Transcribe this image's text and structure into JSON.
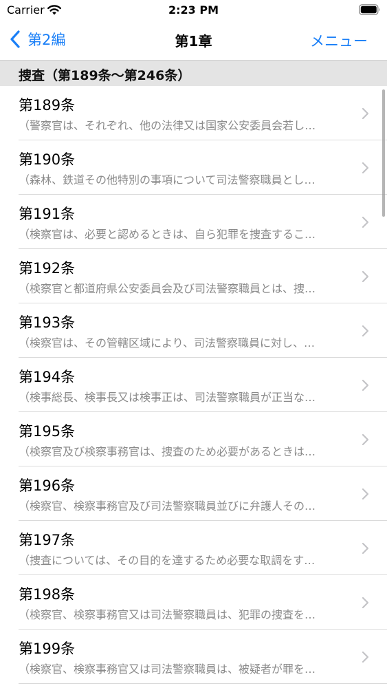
{
  "status_bar": {
    "carrier": "Carrier",
    "time": "2:23 PM"
  },
  "nav": {
    "back_label": "第2編",
    "title": "第1章",
    "menu_label": "メニュー"
  },
  "section": {
    "title": "捜査（第189条〜第246条）"
  },
  "rows": [
    {
      "title": "第189条",
      "subtitle": "（警察官は、それぞれ、他の法律又は国家公安委員会若し…"
    },
    {
      "title": "第190条",
      "subtitle": "（森林、鉄道その他特別の事項について司法警察職員とし…"
    },
    {
      "title": "第191条",
      "subtitle": "（検察官は、必要と認めるときは、自ら犯罪を捜査するこ…"
    },
    {
      "title": "第192条",
      "subtitle": "（検察官と都道府県公安委員会及び司法警察職員とは、捜…"
    },
    {
      "title": "第193条",
      "subtitle": "（検察官は、その管轄区域により、司法警察職員に対し、…"
    },
    {
      "title": "第194条",
      "subtitle": "（検事総長、検事長又は検事正は、司法警察職員が正当な…"
    },
    {
      "title": "第195条",
      "subtitle": "（検察官及び検察事務官は、捜査のため必要があるときは…"
    },
    {
      "title": "第196条",
      "subtitle": "（検察官、検察事務官及び司法警察職員並びに弁護人その…"
    },
    {
      "title": "第197条",
      "subtitle": "（捜査については、その目的を達するため必要な取調をす…"
    },
    {
      "title": "第198条",
      "subtitle": "（検察官、検察事務官又は司法警察職員は、犯罪の捜査を…"
    },
    {
      "title": "第199条",
      "subtitle": "（検察官、検察事務官又は司法警察職員は、被疑者が罪を…"
    }
  ],
  "colors": {
    "accent": "#1a7ff7",
    "section_bg": "#e4e4e4",
    "subtitle": "#8a8a8a"
  },
  "icons": {
    "back": "chevron-left-icon",
    "disclosure": "chevron-right-icon",
    "wifi": "wifi-icon",
    "battery": "battery-icon"
  }
}
